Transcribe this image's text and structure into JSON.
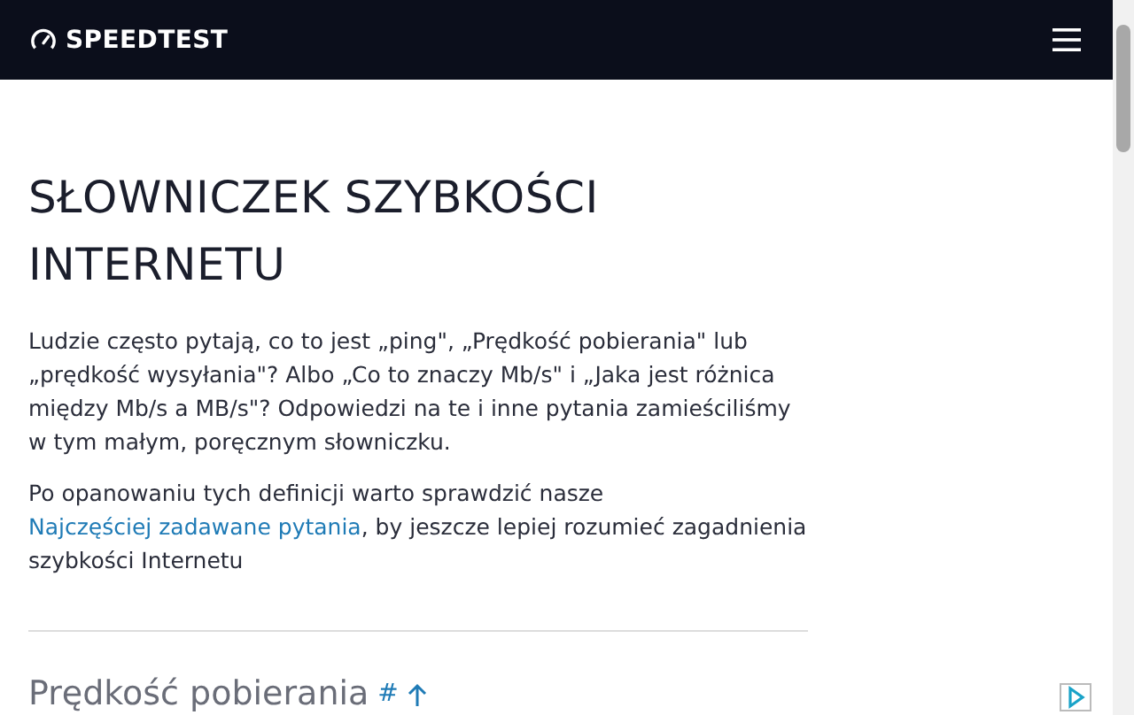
{
  "header": {
    "logo": "SPEEDTEST"
  },
  "title": "SŁOWNICZEK SZYBKOŚCI INTERNETU",
  "intro": "Ludzie często pytają, co to jest „ping\", „Prędkość pobierania\" lub „prędkość wysyłania\"? Albo „Co to znaczy Mb/s\" i „Jaka jest różnica między Mb/s a MB/s\"? Odpowiedzi na te i inne pytania zamieściliśmy w tym małym, poręcznym słowniczku.",
  "followup": {
    "before": "Po opanowaniu tych definicji warto sprawdzić nasze ",
    "link": "Najczęściej zadawane pytania",
    "after": ", by jeszcze lepiej rozumieć zagadnienia szybkości Internetu"
  },
  "section": {
    "heading": "Prędkość pobierania",
    "anchor": "#"
  }
}
